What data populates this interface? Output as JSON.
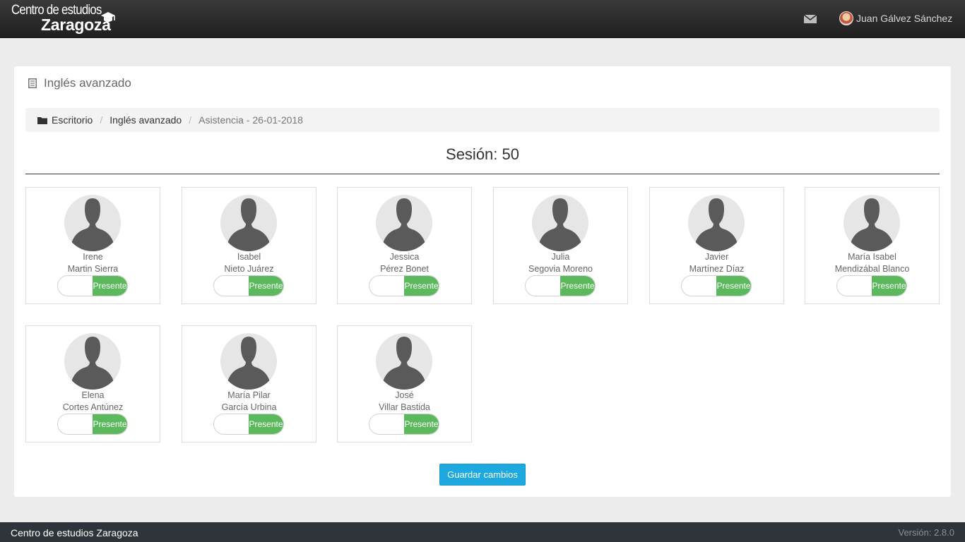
{
  "header": {
    "brand_line1": "Centro de estudios",
    "brand_line2": "Zaragoza",
    "user_name": "Juan Gálvez Sánchez"
  },
  "panel": {
    "title": "Inglés avanzado"
  },
  "breadcrumb": {
    "items": [
      "Escritorio",
      "Inglés avanzado"
    ],
    "current": "Asistencia - 26-01-2018"
  },
  "session": {
    "title": "Sesión: 50"
  },
  "students": [
    {
      "first_name": "Irene",
      "last_name": "Martin Sierra",
      "status": "Presente"
    },
    {
      "first_name": "Isabel",
      "last_name": "Nieto Juárez",
      "status": "Presente"
    },
    {
      "first_name": "Jessica",
      "last_name": "Pérez Bonet",
      "status": "Presente"
    },
    {
      "first_name": "Julia",
      "last_name": "Segovia Moreno",
      "status": "Presente"
    },
    {
      "first_name": "Javier",
      "last_name": "Martínez Díaz",
      "status": "Presente"
    },
    {
      "first_name": "María Isabel",
      "last_name": "Mendizábal Blanco",
      "status": "Presente"
    },
    {
      "first_name": "Elena",
      "last_name": "Cortes Antúnez",
      "status": "Presente"
    },
    {
      "first_name": "María Pilar",
      "last_name": "García Urbina",
      "status": "Presente"
    },
    {
      "first_name": "José",
      "last_name": "Villar Bastida",
      "status": "Presente"
    }
  ],
  "actions": {
    "save_label": "Guardar cambios"
  },
  "footer": {
    "left": "Centro de estudios Zaragoza",
    "version": "Versión: 2.8.0"
  },
  "colors": {
    "toggle_on": "#5cb85c",
    "primary_button": "#1da8df",
    "footer_bg": "#2f343a"
  }
}
